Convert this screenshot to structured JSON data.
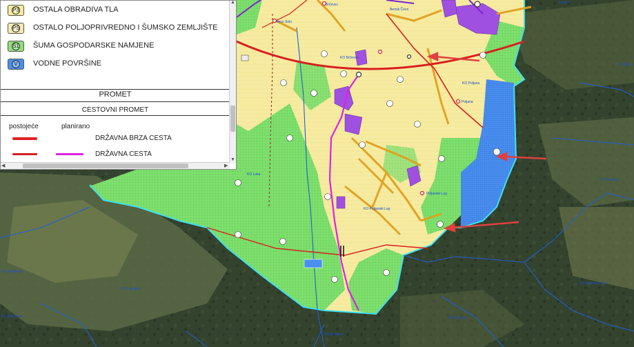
{
  "legend": {
    "items": [
      {
        "code": "P3",
        "label": "OSTALA OBRADIVA TLA",
        "color": "#f5ec9a"
      },
      {
        "code": "PŠ",
        "label": "OSTALO POLJOPRIVREDNO I ŠUMSKO ZEMLJIŠTE",
        "color": "#f5eab0"
      },
      {
        "code": "Š1",
        "label": "ŠUMA GOSPODARSKE NAMJENE",
        "color": "#8fe07a"
      },
      {
        "code": "V",
        "label": "VODNE POVRŠINE",
        "color": "#4a8ff0"
      }
    ],
    "section_title": "PROMET",
    "subsection_title": "CESTOVNI PROMET",
    "col_existing": "postojeće",
    "col_planned": "planirano",
    "roads": [
      {
        "label": "DRŽAVNA BRZA CESTA",
        "existing_color": "#e02020",
        "planned_color": null
      },
      {
        "label": "DRŽAVNA CESTA",
        "existing_color": "#d02020",
        "planned_color": "#e020e0"
      }
    ]
  },
  "map": {
    "place_labels": [
      {
        "text": "KO Brčevec"
      },
      {
        "text": "Brčevec"
      },
      {
        "text": "Poljana"
      },
      {
        "text": "KO Poljana"
      },
      {
        "text": "Poljanski Lug"
      },
      {
        "text": "KO Poljanski Lug"
      },
      {
        "text": "KO Luka"
      },
      {
        "text": "Novo Selo"
      },
      {
        "text": "Bernik Čevo"
      },
      {
        "text": "KO Preseka"
      },
      {
        "text": "KO Lupoglav"
      },
      {
        "text": "KO Oborovo"
      },
      {
        "text": "KO Martinska Ves"
      },
      {
        "text": "KO Andrilovec"
      },
      {
        "text": "KO Greda"
      },
      {
        "text": "KO Obedišće"
      },
      {
        "text": "KO Bošnjaci"
      },
      {
        "text": "KO Andrilovec"
      },
      {
        "text": "Gradec"
      },
      {
        "text": "KO Breg"
      }
    ],
    "colors": {
      "forest_bg": "#34432e",
      "agri_yellow": "#f6eba0",
      "forest_green": "#7fe06e",
      "water_blue": "#4a8ff0",
      "boundary_cyan": "#40e0f0",
      "built_purple": "#a050e0",
      "road_red": "#d81e1e",
      "road_magenta": "#e020e0",
      "cadastral_blue": "#2060d0"
    }
  }
}
